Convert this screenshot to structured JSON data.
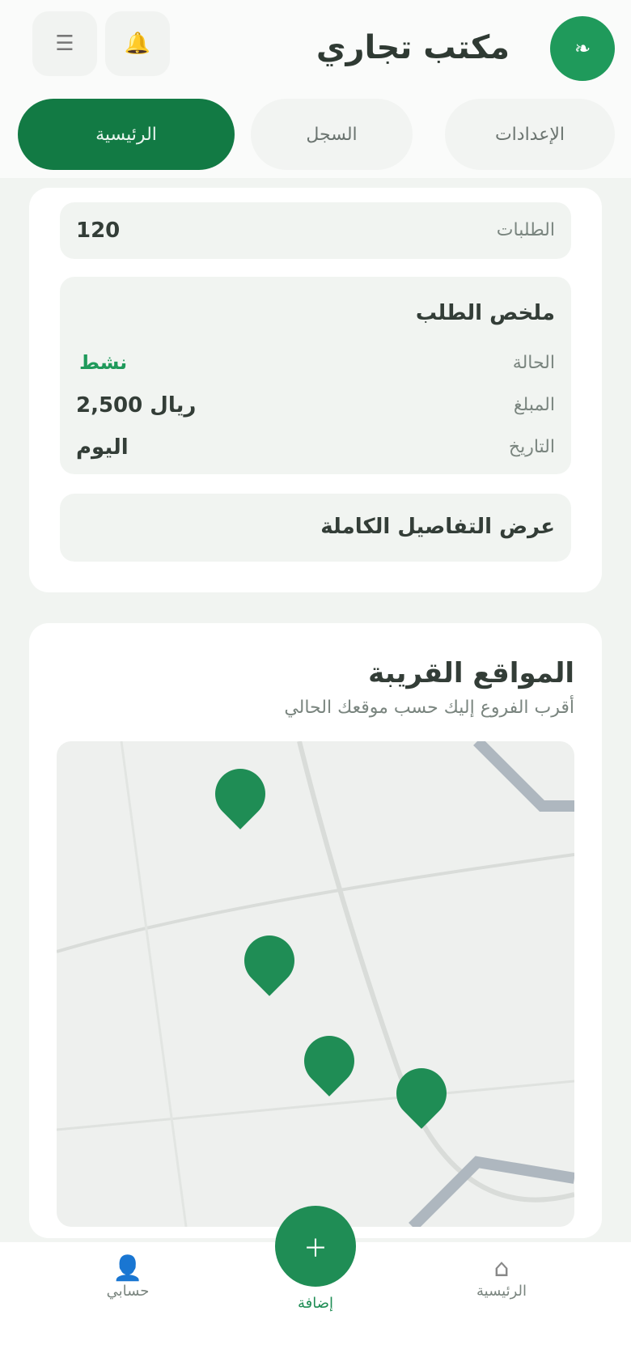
{
  "header": {
    "title": "مكتب تجاري",
    "logo_icon": "leaf-icon",
    "left_buttons": [
      "menu-icon",
      "bell-icon"
    ]
  },
  "tabs": [
    {
      "label": "الرئيسية"
    },
    {
      "label": "السجل"
    },
    {
      "label": "الإعدادات"
    }
  ],
  "summary": {
    "top_row_value": "120",
    "top_row_label": "الطلبات",
    "section_title": "ملخص الطلب",
    "items": [
      {
        "label": "الحالة",
        "value": "نشط",
        "value_color": "#1f9a5b"
      },
      {
        "label": "المبلغ",
        "value": "2,500 ريال"
      },
      {
        "label": "التاريخ",
        "value": "اليوم"
      }
    ],
    "footer": "عرض التفاصيل الكاملة"
  },
  "map_section": {
    "title": "المواقع القريبة",
    "subtitle": "أقرب الفروع إليك حسب موقعك الحالي"
  },
  "bottom_nav": {
    "left": {
      "label": "حسابي",
      "icon": "user-icon"
    },
    "center": {
      "label": "إضافة",
      "icon": "plus-icon"
    },
    "right": {
      "label": "الرئيسية",
      "icon": "home-icon"
    }
  },
  "colors": {
    "primary": "#127a44",
    "accent": "#1f8d55",
    "background": "#f1f4f1"
  }
}
